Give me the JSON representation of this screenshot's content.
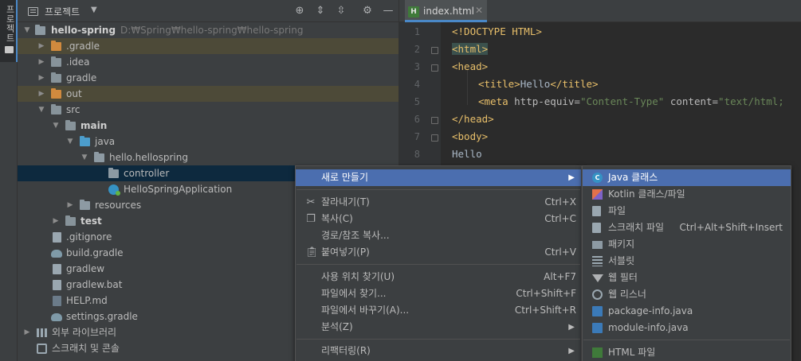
{
  "side_strip": {
    "tab_label": "프로젝트"
  },
  "project_panel": {
    "title": "프로젝트",
    "tools": [
      "locate-icon",
      "expand-all-icon",
      "collapse-all-icon",
      "settings-icon",
      "minimize-icon"
    ],
    "tree": [
      {
        "label": "hello-spring",
        "hint": "D:₩Spring₩hello-spring₩hello-spring"
      },
      {
        "label": ".gradle"
      },
      {
        "label": ".idea"
      },
      {
        "label": "gradle"
      },
      {
        "label": "out"
      },
      {
        "label": "src"
      },
      {
        "label": "main"
      },
      {
        "label": "java"
      },
      {
        "label": "hello.hellospring"
      },
      {
        "label": "controller"
      },
      {
        "label": "HelloSpringApplication"
      },
      {
        "label": "resources"
      },
      {
        "label": "test"
      },
      {
        "label": ".gitignore"
      },
      {
        "label": "build.gradle"
      },
      {
        "label": "gradlew"
      },
      {
        "label": "gradlew.bat"
      },
      {
        "label": "HELP.md"
      },
      {
        "label": "settings.gradle"
      },
      {
        "label": "외부 라이브러리"
      },
      {
        "label": "스크래치 및 콘솔"
      }
    ]
  },
  "editor": {
    "tab": {
      "title": "index.html",
      "icon_text": "H"
    },
    "line_numbers": [
      "1",
      "2",
      "3",
      "4",
      "5",
      "6",
      "7",
      "8"
    ],
    "code": {
      "l1": "<!DOCTYPE HTML>",
      "l2": "<html>",
      "l3": "<head>",
      "l4a": "<title>",
      "l4b": "Hello",
      "l4c": "</title>",
      "l5a": "<meta ",
      "l5b": "http-equiv=",
      "l5c": "\"Content-Type\"",
      "l5d": " content=",
      "l5e": "\"text/html;",
      "l6": "</head>",
      "l7": "<body>",
      "l8": "Hello"
    }
  },
  "context_menu": {
    "items": [
      {
        "label": "새로 만들기",
        "shortcut": ""
      },
      {
        "label": "잘라내기(T)",
        "shortcut": "Ctrl+X"
      },
      {
        "label": "복사(C)",
        "shortcut": "Ctrl+C"
      },
      {
        "label": "경로/참조 복사...",
        "shortcut": ""
      },
      {
        "label": "붙여넣기(P)",
        "shortcut": "Ctrl+V"
      },
      {
        "label": "사용 위치 찾기(U)",
        "shortcut": "Alt+F7"
      },
      {
        "label": "파일에서 찾기...",
        "shortcut": "Ctrl+Shift+F"
      },
      {
        "label": "파일에서 바꾸기(A)...",
        "shortcut": "Ctrl+Shift+R"
      },
      {
        "label": "분석(Z)",
        "shortcut": ""
      },
      {
        "label": "리팩터링(R)",
        "shortcut": ""
      }
    ]
  },
  "submenu": {
    "items": [
      {
        "label": "Java 클래스",
        "shortcut": ""
      },
      {
        "label": "Kotlin 클래스/파일",
        "shortcut": ""
      },
      {
        "label": "파일",
        "shortcut": ""
      },
      {
        "label": "스크래치 파일",
        "shortcut": "Ctrl+Alt+Shift+Insert"
      },
      {
        "label": "패키지",
        "shortcut": ""
      },
      {
        "label": "서블릿",
        "shortcut": ""
      },
      {
        "label": "웹 필터",
        "shortcut": ""
      },
      {
        "label": "웹 리스너",
        "shortcut": ""
      },
      {
        "label": "package-info.java",
        "shortcut": ""
      },
      {
        "label": "module-info.java",
        "shortcut": ""
      },
      {
        "label": "HTML 파일",
        "shortcut": ""
      }
    ]
  }
}
